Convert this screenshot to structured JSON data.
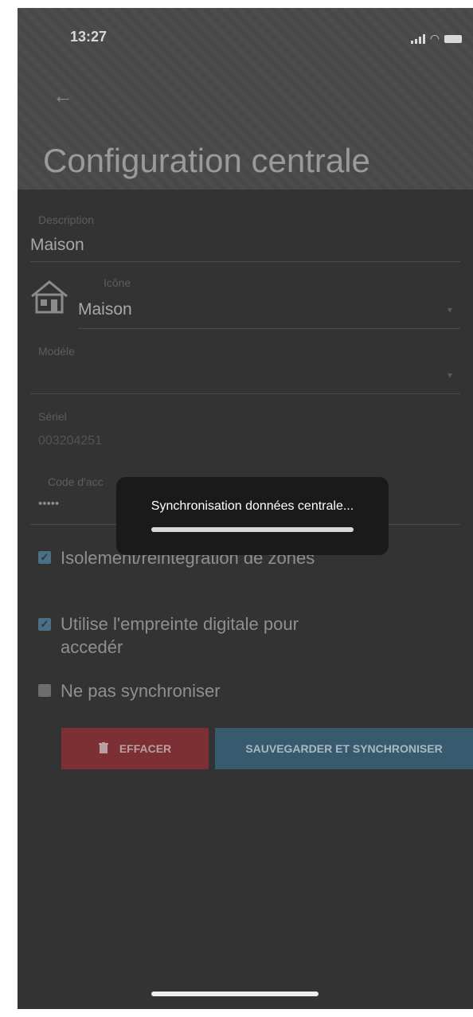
{
  "status": {
    "time": "13:27"
  },
  "header": {
    "title": "Configuration centrale"
  },
  "form": {
    "description": {
      "label": "Description",
      "value": "Maison"
    },
    "icone": {
      "label": "Icône",
      "value": "Maison"
    },
    "modele": {
      "label": "Modèle",
      "value": ""
    },
    "seriel": {
      "label": "Sériel",
      "value": "003204251"
    },
    "code": {
      "label": "Code d'acc",
      "value": "•••••"
    }
  },
  "options": [
    {
      "label": "Isolement/réintégration de zones",
      "checked": true
    },
    {
      "label": "Utilise l'empreinte digitale pour accedér",
      "checked": true
    },
    {
      "label": "Ne pas synchroniser",
      "checked": false
    }
  ],
  "buttons": {
    "delete": "EFFACER",
    "save": "SAUVEGARDER ET SYNCHRONISER"
  },
  "toast": {
    "message": "Synchronisation données centrale..."
  },
  "colors": {
    "delete": "#7d3034",
    "save": "#385a6e",
    "check": "#4b6f86"
  }
}
